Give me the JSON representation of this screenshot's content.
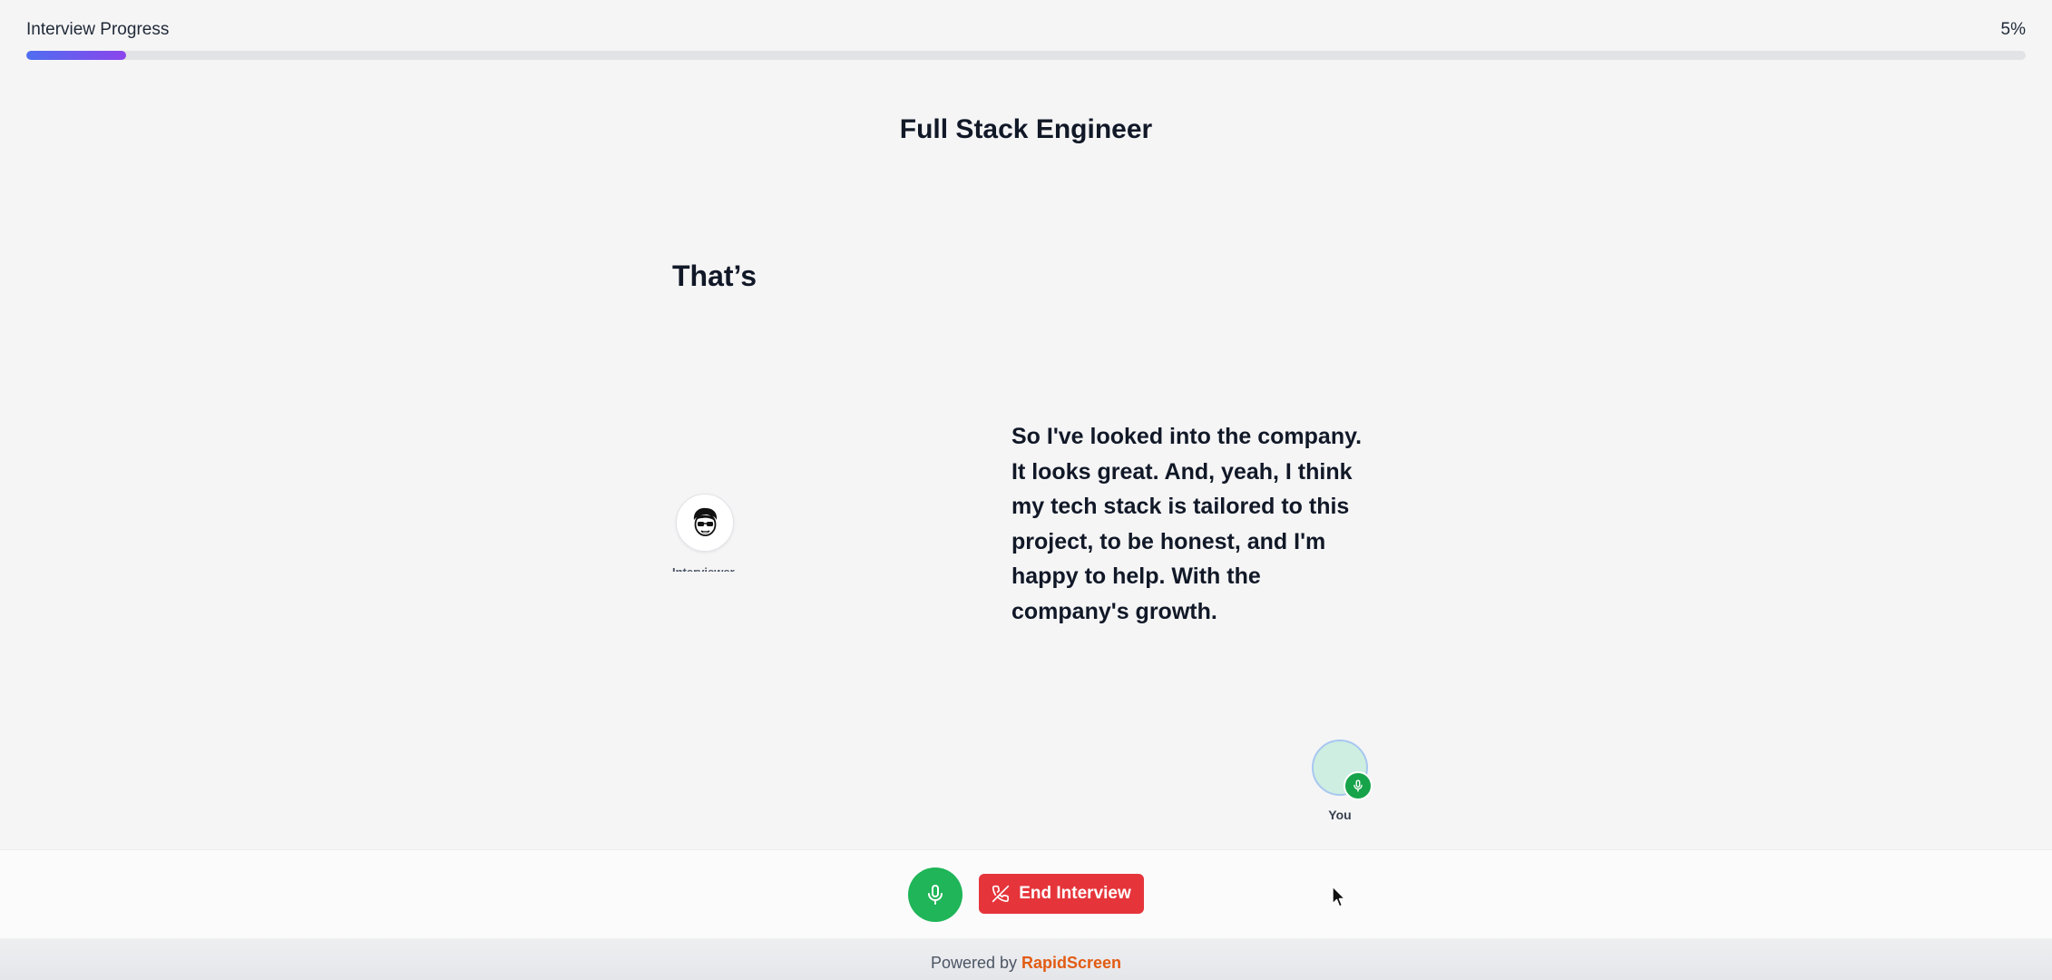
{
  "progress": {
    "label": "Interview Progress",
    "percent_text": "5%",
    "fraction": 0.05
  },
  "job": {
    "title": "Full Stack Engineer"
  },
  "interviewer": {
    "current_text": "That’s",
    "label": "Interviewer"
  },
  "candidate": {
    "transcript": "So I've looked into the company. It looks great. And, yeah, I think my tech stack is tailored to this project, to be honest, and I'm happy to help. With the company's growth.",
    "label": "You"
  },
  "controls": {
    "end_label": "End Interview"
  },
  "footer": {
    "prefix": "Powered by ",
    "brand": "RapidScreen"
  },
  "colors": {
    "accent_start": "#4f6ef0",
    "accent_end": "#8b45ec",
    "mic_green": "#1fb558",
    "end_red": "#e5353b",
    "brand_orange": "#e25b12"
  },
  "icons": {
    "mic": "microphone-icon",
    "end": "phone-off-icon",
    "interviewer_avatar": "cartoon-face-icon"
  }
}
